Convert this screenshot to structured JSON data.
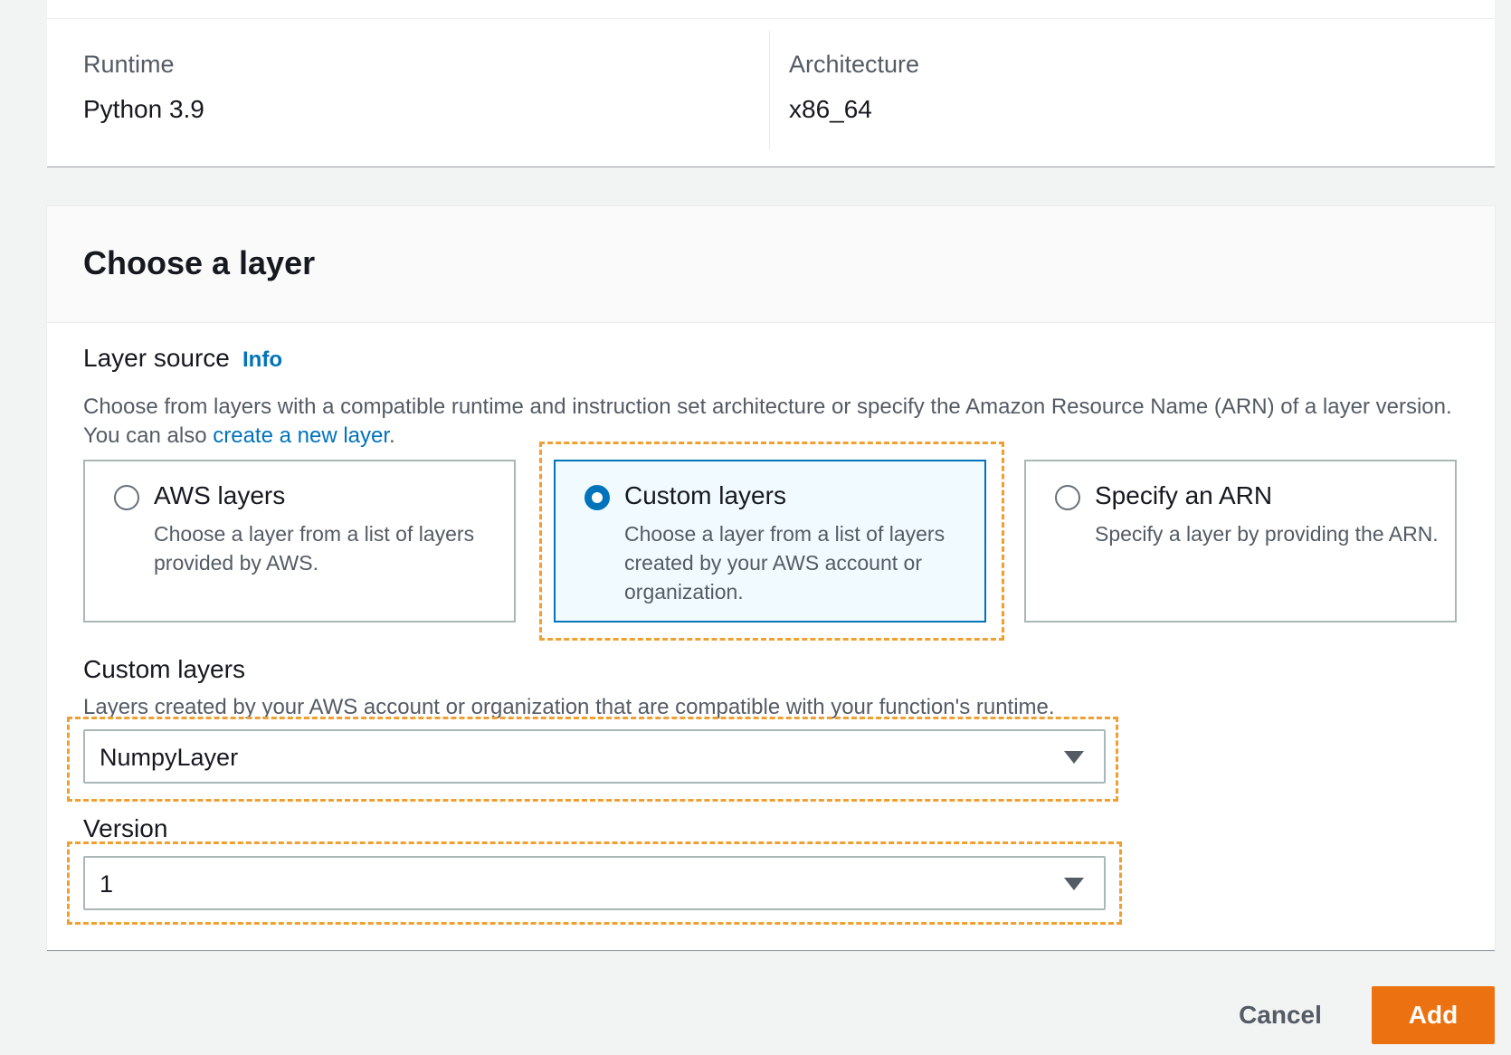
{
  "runtime_panel": {
    "runtime_label": "Runtime",
    "runtime_value": "Python 3.9",
    "architecture_label": "Architecture",
    "architecture_value": "x86_64"
  },
  "choose_layer": {
    "title": "Choose a layer",
    "layer_source": {
      "label": "Layer source",
      "info": "Info",
      "description_pre": "Choose from layers with a compatible runtime and instruction set architecture or specify the Amazon Resource Name (ARN) of a layer version. You can also ",
      "description_link": "create a new layer",
      "description_post": ".",
      "options": [
        {
          "title": "AWS layers",
          "description": "Choose a layer from a list of layers provided by AWS.",
          "selected": false
        },
        {
          "title": "Custom layers",
          "description": "Choose a layer from a list of layers created by your AWS account or organization.",
          "selected": true
        },
        {
          "title": "Specify an ARN",
          "description": "Specify a layer by providing the ARN.",
          "selected": false
        }
      ]
    },
    "custom_layers": {
      "label": "Custom layers",
      "description": "Layers created by your AWS account or organization that are compatible with your function's runtime.",
      "selected_value": "NumpyLayer"
    },
    "version": {
      "label": "Version",
      "selected_value": "1"
    }
  },
  "footer": {
    "cancel_label": "Cancel",
    "add_label": "Add"
  },
  "colors": {
    "accent": "#0073bb",
    "primary_button": "#ec7211",
    "highlight_annotation": "#f0a030"
  }
}
